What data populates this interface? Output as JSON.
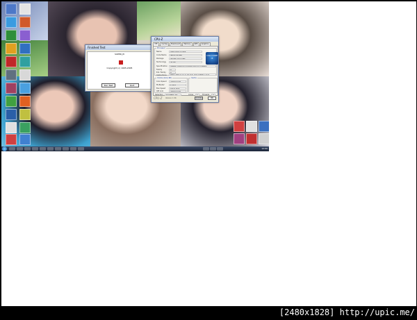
{
  "watermark": {
    "resolution": "[2480x1828]",
    "url": "http://upic.me/"
  },
  "superpi": {
    "title": "Finished Test",
    "line1": "SUPER_PI",
    "line2": "Copyright (c) 1995-2005",
    "line3": "",
    "run_label": "Run Test",
    "quit_label": "Quit"
  },
  "cpuz": {
    "title": "CPU-Z",
    "tabs": [
      "CPU",
      "Caches",
      "Mainboard",
      "Memory",
      "SPD",
      "Graphics",
      "About"
    ],
    "processor_label": "Processor",
    "clocks_label": "Clocks (Core #0)",
    "cache_label": "Cache",
    "rows": [
      {
        "label": "Name",
        "value": "Intel Core i3 2100"
      },
      {
        "label": "Code Name",
        "value": "Sandy Bridge"
      },
      {
        "label": "Package",
        "value": "Socket 1155 LGA"
      },
      {
        "label": "Technology",
        "value": "32 nm"
      },
      {
        "label": "Specification",
        "value": "Intel(R) Core(TM) i3-2100 CPU @ 3.10GHz"
      },
      {
        "label": "Family",
        "value": "6"
      },
      {
        "label": "Ext. Family",
        "value": "6"
      },
      {
        "label": "Instructions",
        "value": "MMX, SSE (1, 2, 3, 3S, 4.1, 4.2), EM64T, VT-x"
      }
    ],
    "clocks": [
      {
        "label": "Core Speed",
        "value": "3100.0 MHz"
      },
      {
        "label": "Multiplier",
        "value": "x 31.0"
      },
      {
        "label": "Bus Speed",
        "value": "100.0 MHz"
      },
      {
        "label": "QPI Link",
        "value": "3200.0 MHz"
      }
    ],
    "selection_label": "Selection",
    "selection_value": "Processor #1",
    "cores_label": "Cores",
    "cores_value": "2",
    "threads_label": "Threads",
    "threads_value": "4",
    "brand": "CPU-Z",
    "version": "Version 1.56",
    "validate_label": "Validate",
    "ok_label": "OK",
    "intel_badge": "intel CORE i3"
  },
  "taskbar": {
    "clock": "12:00"
  }
}
